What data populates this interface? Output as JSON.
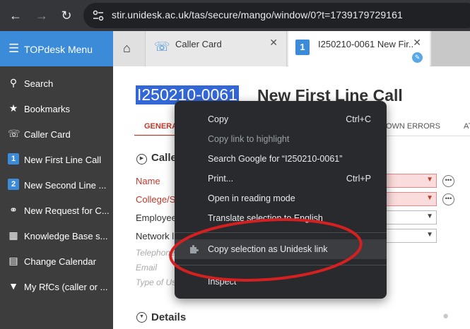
{
  "browser": {
    "url": "stir.unidesk.ac.uk/tas/secure/mango/window/0?t=1739179729161"
  },
  "sidebar": {
    "header_label": "TOPdesk Menu",
    "items": [
      {
        "label": "Search",
        "icon": "search-icon"
      },
      {
        "label": "Bookmarks",
        "icon": "bookmark-icon"
      },
      {
        "label": "Caller Card",
        "icon": "caller-card-icon"
      },
      {
        "label": "New First Line Call",
        "icon": "first-line-call-icon"
      },
      {
        "label": "New Second Line ...",
        "icon": "second-line-call-icon"
      },
      {
        "label": "New Request for C...",
        "icon": "request-change-icon"
      },
      {
        "label": "Knowledge Base s...",
        "icon": "knowledge-base-icon"
      },
      {
        "label": "Change Calendar",
        "icon": "calendar-icon"
      },
      {
        "label": "My RfCs (caller or ...",
        "icon": "filter-icon"
      }
    ]
  },
  "tabs": {
    "caller_card": "Caller Card",
    "call": "I250210-0061 New Fir..."
  },
  "main": {
    "call_id": "I250210-0061",
    "call_title": "New First Line Call",
    "tab_general": "GENERA",
    "tab_known_errors": "NOWN ERRORS",
    "tab_at": "AT",
    "caller_section": "Calle",
    "fields": {
      "name": "Name",
      "college": "College/S",
      "employee": "Employee",
      "network": "Network l",
      "telephone": "Telephone",
      "email": "Email",
      "type_of_user": "Type of Us"
    },
    "details_section": "Details"
  },
  "context_menu": {
    "items": [
      {
        "label": "Copy",
        "shortcut": "Ctrl+C",
        "enabled": true
      },
      {
        "label": "Copy link to highlight",
        "shortcut": "",
        "enabled": false
      },
      {
        "label": "Search Google for “I250210-0061”",
        "shortcut": "",
        "enabled": true
      },
      {
        "label": "Print...",
        "shortcut": "Ctrl+P",
        "enabled": true
      },
      {
        "label": "Open in reading mode",
        "shortcut": "",
        "enabled": true
      },
      {
        "label": "Translate selection to English",
        "shortcut": "",
        "enabled": true
      },
      {
        "label": "Copy selection as Unidesk link",
        "shortcut": "",
        "enabled": true
      },
      {
        "label": "Inspect",
        "shortcut": "",
        "enabled": true
      }
    ]
  },
  "colors": {
    "accent_blue": "#3b8bd8",
    "selection_blue": "#3367d6",
    "error_red": "#c0392b",
    "annotation_red": "#d42020"
  }
}
